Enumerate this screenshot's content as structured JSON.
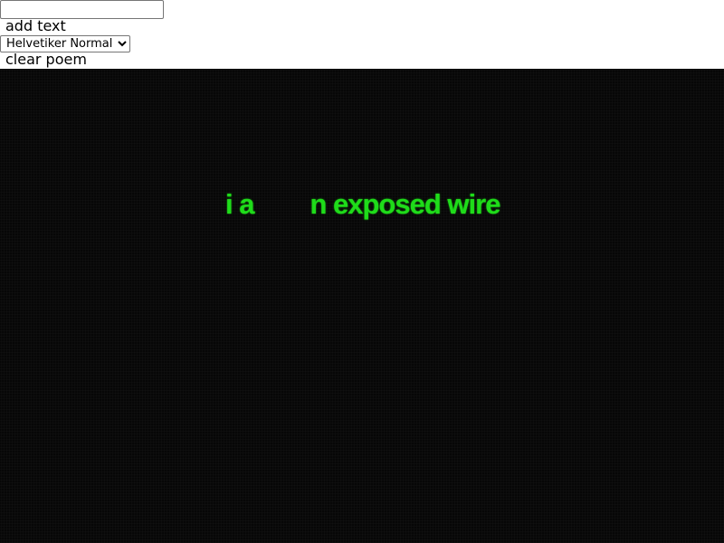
{
  "controls": {
    "text_input_value": "",
    "add_label": "add text",
    "font_selected": "Helvetiker Normal",
    "clear_label": "clear poem"
  },
  "poem": {
    "part_left": "i a",
    "part_right": "n exposed wire",
    "color": "#1fdc1a"
  },
  "stage": {
    "background": "#070707"
  }
}
